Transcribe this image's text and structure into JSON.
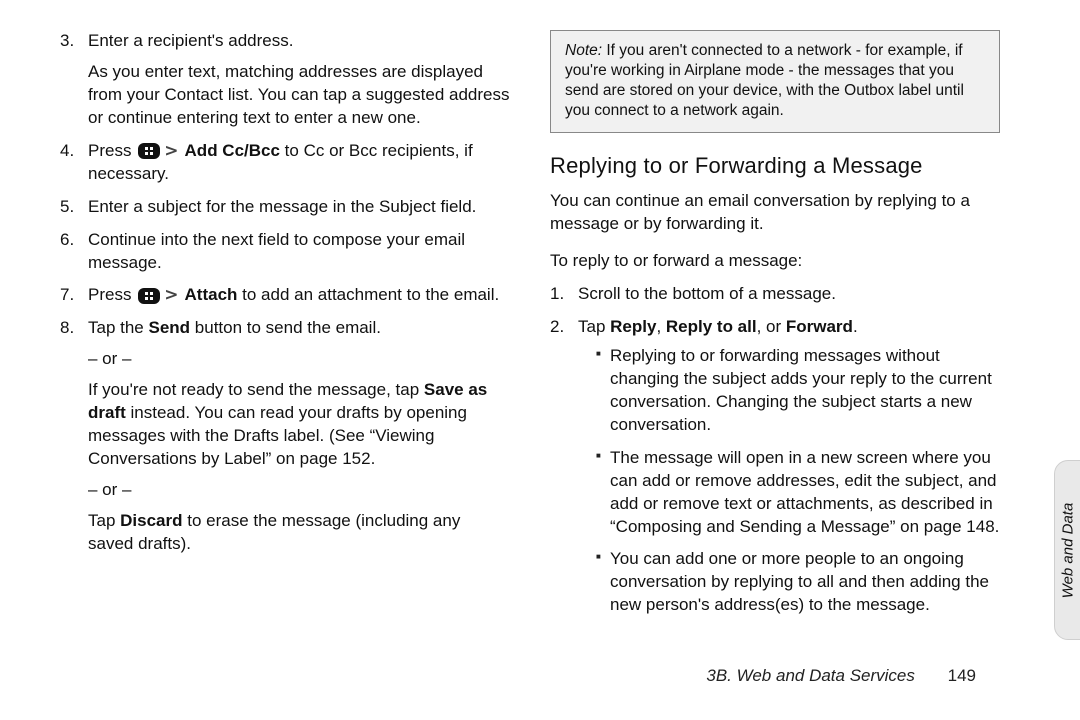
{
  "left": {
    "i3": {
      "num": "3.",
      "t1": "Enter a recipient's address.",
      "t2": "As you enter text, matching addresses are displayed from your Contact list. You can tap a suggested address or continue entering text to enter a new one."
    },
    "i4": {
      "num": "4.",
      "pre": "Press ",
      "bold": " Add Cc/Bcc",
      "post": " to Cc or Bcc recipients, if necessary."
    },
    "i5": {
      "num": "5.",
      "t": "Enter a subject for the message in the Subject field."
    },
    "i6": {
      "num": "6.",
      "t": "Continue into the next field to compose your email message."
    },
    "i7": {
      "num": "7.",
      "pre": "Press ",
      "bold": " Attach",
      "post": " to add an attachment to the email."
    },
    "i8": {
      "num": "8.",
      "p1a": "Tap the ",
      "p1b": "Send",
      "p1c": " button to send the email.",
      "or": "– or –",
      "p2a": "If you're not ready to send the message, tap ",
      "p2b": "Save as draft",
      "p2c": " instead. You can read your drafts by opening messages with the Drafts label. (See “Viewing Conversations by Label” on page 152.",
      "p3a": "Tap ",
      "p3b": "Discard",
      "p3c": " to erase the message (including any saved drafts)."
    }
  },
  "right": {
    "note": {
      "label": "Note:",
      "body": "  If you aren't connected to a network - for example, if you're working in Airplane mode - the messages that you send are stored on your device, with the Outbox label until you connect to a network again."
    },
    "h2": "Replying to or Forwarding a Message",
    "lead": "You can continue an email conversation by replying to a message or by forwarding it.",
    "subhead": "To reply to or forward a message:",
    "s1": {
      "num": "1.",
      "t": "Scroll to the bottom of a message."
    },
    "s2": {
      "num": "2.",
      "a": "Tap ",
      "b1": "Reply",
      "c1": ", ",
      "b2": "Reply to all",
      "c2": ", or ",
      "b3": "Forward",
      "c3": "."
    },
    "b1": "Replying to or forwarding messages without changing the subject adds your reply to the current conversation. Changing the subject starts a new conversation.",
    "b2": "The message will open in a new screen where you can add or remove addresses, edit the subject, and add or remove text or attachments, as described in “Composing and Sending a Message” on page 148.",
    "b3": "You can add one or more people to an ongoing conversation by replying to all and then adding the new person's address(es) to the message."
  },
  "footer": {
    "section": "3B. Web and Data Services",
    "page": "149"
  },
  "sidetab": "Web and Data",
  "gt": ">"
}
